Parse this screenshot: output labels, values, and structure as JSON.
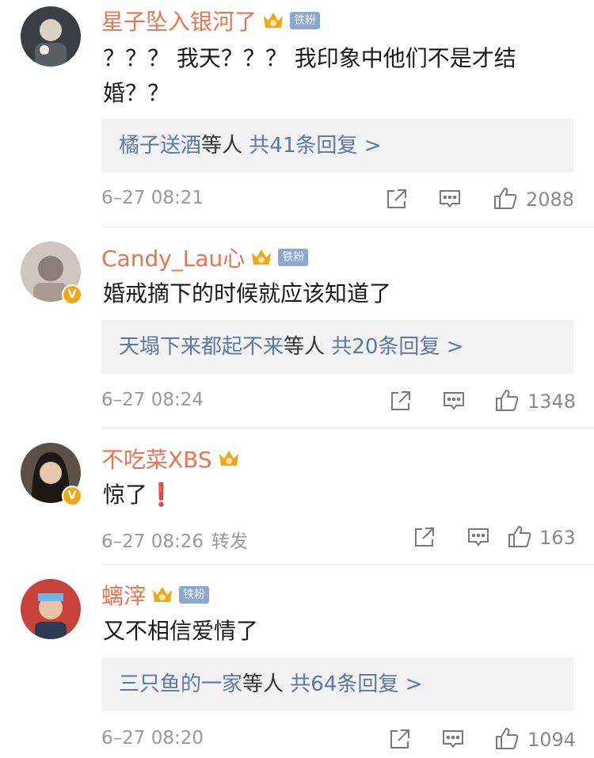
{
  "comments": [
    {
      "name": "星子坠入银河了",
      "fan_badge": "铁粉",
      "verified": false,
      "text_lines": [
        "？？？ 我天？？？ 我印象中他们不是才结",
        "婚？？"
      ],
      "reply": {
        "users": "橘子送酒",
        "suffix": "等人",
        "count": "共41条回复 >"
      },
      "time": "6–27 08:21",
      "forward_label": "",
      "likes": "2088"
    },
    {
      "name": "Candy_Lau心",
      "fan_badge": "铁粉",
      "verified": true,
      "text_lines": [
        "婚戒摘下的时候就应该知道了"
      ],
      "reply": {
        "users": "天塌下来都起不来",
        "suffix": "等人",
        "count": "共20条回复 >"
      },
      "time": "6–27 08:24",
      "forward_label": "",
      "likes": "1348"
    },
    {
      "name": "不吃菜XBS",
      "fan_badge": "",
      "verified": true,
      "text_lines": [
        "惊了❗"
      ],
      "reply": null,
      "time": "6–27 08:26",
      "forward_label": "转发",
      "likes": "163"
    },
    {
      "name": "螭滓",
      "fan_badge": "铁粉",
      "verified": false,
      "text_lines": [
        "又不相信爱情了"
      ],
      "reply": {
        "users": "三只鱼的一家",
        "suffix": "等人",
        "count": "共64条回复 >"
      },
      "time": "6–27 08:20",
      "forward_label": "",
      "likes": "1094"
    }
  ],
  "colors": {
    "name": "#eb7350",
    "reply_link": "#5b78a8",
    "meta": "#9a9a9a",
    "reply_bg": "#f2f2f2",
    "crown": "#f3a712",
    "fan_badge_bg": "#8ba7d6"
  },
  "icons": {
    "forward": "share-icon",
    "comment": "comment-icon",
    "like": "thumbs-up-icon",
    "crown": "crown-icon",
    "verified": "verified-badge-icon"
  }
}
